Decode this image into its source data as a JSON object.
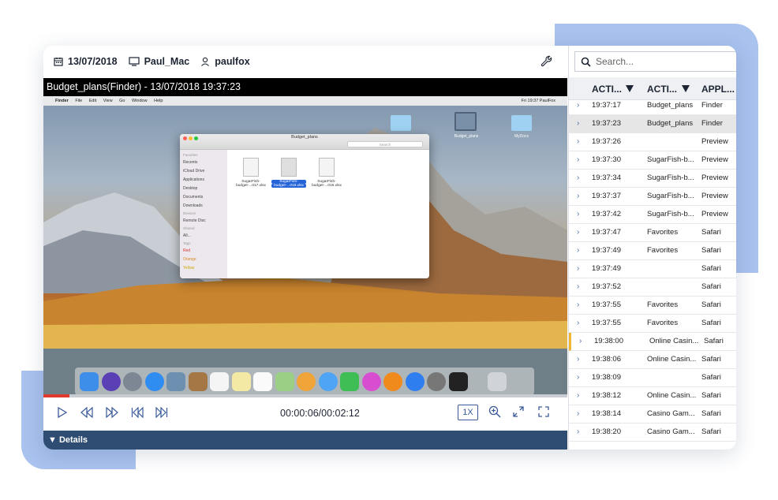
{
  "header": {
    "date": "13/07/2018",
    "computer": "Paul_Mac",
    "user": "paulfox"
  },
  "video": {
    "title": "Budget_plans(Finder) - 13/07/2018 19:37:23",
    "timecode": "00:00:06/00:02:12",
    "speed": "1X",
    "progress": 0.05
  },
  "mac_screen": {
    "menu_left": [
      "Finder",
      "File",
      "Edit",
      "View",
      "Go",
      "Window",
      "Help"
    ],
    "menu_right": "Fri 19:37  PaulFox",
    "desktop_items": [
      "Budget_plans",
      "MyDocs"
    ],
    "finder": {
      "title": "Budget_plans",
      "search_placeholder": "Search",
      "sidebar": [
        {
          "label": "Favorites",
          "header": true
        },
        {
          "label": "Recents"
        },
        {
          "label": "iCloud Drive"
        },
        {
          "label": "Applications"
        },
        {
          "label": "Desktop"
        },
        {
          "label": "Documents"
        },
        {
          "label": "Downloads"
        },
        {
          "label": "Devices",
          "header": true
        },
        {
          "label": "Remote Disc"
        },
        {
          "label": "Shared",
          "header": true
        },
        {
          "label": "All..."
        },
        {
          "label": "Tags",
          "header": true
        },
        {
          "label": "Red"
        },
        {
          "label": "Orange"
        },
        {
          "label": "Yellow"
        }
      ],
      "files": [
        {
          "line1": "SugarFish-",
          "line2": "budget-...017.xlsx",
          "selected": false
        },
        {
          "line1": "SugarFish-",
          "line2": "budget-...018.xlsx",
          "selected": true
        },
        {
          "line1": "SugarFish-",
          "line2": "budget-...016.xlsx",
          "selected": false
        }
      ]
    }
  },
  "details": {
    "label": "▼ Details"
  },
  "activity": {
    "search_placeholder": "Search...",
    "columns": [
      "ACTI...",
      "ACTI...",
      "APPL..."
    ],
    "rows": [
      {
        "time": "19:37:17",
        "activity": "Budget_plans",
        "app": "Finder"
      },
      {
        "time": "19:37:23",
        "activity": "Budget_plans",
        "app": "Finder",
        "highlighted": true
      },
      {
        "time": "19:37:26",
        "activity": "",
        "app": "Preview"
      },
      {
        "time": "19:37:30",
        "activity": "SugarFish-b...",
        "app": "Preview"
      },
      {
        "time": "19:37:34",
        "activity": "SugarFish-b...",
        "app": "Preview"
      },
      {
        "time": "19:37:37",
        "activity": "SugarFish-b...",
        "app": "Preview"
      },
      {
        "time": "19:37:42",
        "activity": "SugarFish-b...",
        "app": "Preview"
      },
      {
        "time": "19:37:47",
        "activity": "Favorites",
        "app": "Safari"
      },
      {
        "time": "19:37:49",
        "activity": "Favorites",
        "app": "Safari"
      },
      {
        "time": "19:37:49",
        "activity": "",
        "app": "Safari"
      },
      {
        "time": "19:37:52",
        "activity": "",
        "app": "Safari"
      },
      {
        "time": "19:37:55",
        "activity": "Favorites",
        "app": "Safari"
      },
      {
        "time": "19:37:55",
        "activity": "Favorites",
        "app": "Safari"
      },
      {
        "time": "19:38:00",
        "activity": "Online Casin...",
        "app": "Safari",
        "marked": true
      },
      {
        "time": "19:38:06",
        "activity": "Online Casin...",
        "app": "Safari"
      },
      {
        "time": "19:38:09",
        "activity": "",
        "app": "Safari"
      },
      {
        "time": "19:38:12",
        "activity": "Online Casin...",
        "app": "Safari"
      },
      {
        "time": "19:38:14",
        "activity": "Casino Gam...",
        "app": "Safari"
      },
      {
        "time": "19:38:20",
        "activity": "Casino Gam...",
        "app": "Safari"
      }
    ]
  },
  "colors": {
    "accent": "#3a5a9a",
    "details_bar": "#2f4d73",
    "progress_fill": "#e03a2f",
    "highlight_row": "#e6e6e6",
    "marker": "#f2b632",
    "decor": "#a9c2ee"
  },
  "icons": [
    "calendar-icon",
    "monitor-icon",
    "user-icon",
    "wrench-icon",
    "search-icon",
    "filter-icon",
    "play-icon",
    "rewind-icon",
    "fast-forward-icon",
    "skip-back-icon",
    "skip-forward-icon",
    "zoom-in-icon",
    "expand-icon",
    "fullscreen-icon",
    "chevron-right-icon"
  ]
}
